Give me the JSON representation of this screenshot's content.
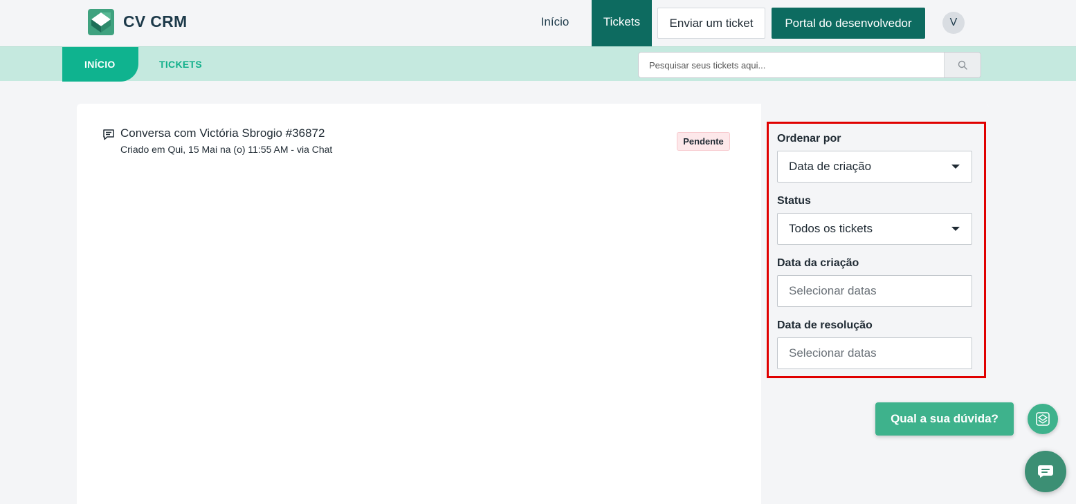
{
  "header": {
    "brand": "CV CRM",
    "nav": {
      "inicio": "Início",
      "tickets": "Tickets"
    },
    "submit_ticket": "Enviar um ticket",
    "developer_portal": "Portal do desenvolvedor",
    "avatar_initial": "V"
  },
  "subnav": {
    "inicio": "INÍCIO",
    "tickets": "TICKETS",
    "search_placeholder": "Pesquisar seus tickets aqui..."
  },
  "ticket": {
    "title": "Conversa com Victória Sbrogio #36872",
    "subtitle": "Criado em Qui, 15 Mai na (o) 11:55 AM - via Chat",
    "status": "Pendente"
  },
  "filters": {
    "order_label": "Ordenar por",
    "order_value": "Data de criação",
    "status_label": "Status",
    "status_value": "Todos os tickets",
    "created_label": "Data da criação",
    "created_placeholder": "Selecionar datas",
    "resolved_label": "Data de resolução",
    "resolved_placeholder": "Selecionar datas"
  },
  "help": {
    "question": "Qual a sua dúvida?"
  },
  "colors": {
    "primary": "#0d6b60",
    "accent": "#0fb38f",
    "subnav_bg": "#c5e9df",
    "highlight": "#e00000"
  }
}
